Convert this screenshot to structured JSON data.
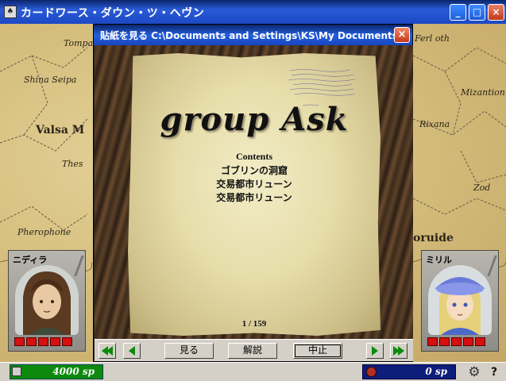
{
  "window": {
    "title": "カードワース・ダウン・ツ・ヘヴン",
    "icon": "card-icon",
    "controls": {
      "minimize": "_",
      "maximize": "□",
      "close": "×"
    }
  },
  "map": {
    "towns": [
      "Tompa",
      "Shina Seipa",
      "Valsa M",
      "Thes",
      "Pherophone",
      "Ferl oth",
      "Mizantion",
      "Rixana",
      "Zod",
      "oruide"
    ]
  },
  "dialog": {
    "title": "貼紙を見る C:\\Documents and Settings\\KS\\My Documents\\まとめ…",
    "close": "×",
    "paper": {
      "heading": "group Ask",
      "contents_label": "Contents",
      "contents": [
        "ゴブリンの洞窟",
        "交易都市リューン",
        "交易都市リューン"
      ],
      "page_counter": "1 / 159"
    },
    "toolbar": {
      "view_label": "見る",
      "explain_label": "解説",
      "cancel_label": "中止"
    }
  },
  "party": [
    {
      "name": "ニディラ",
      "hp_pips": 5
    },
    {
      "name": "ミリル",
      "hp_pips": 5
    }
  ],
  "status": {
    "money_left": "4000 sp",
    "money_right": "0 sp",
    "help": "?"
  },
  "colors": {
    "titlebar": "#245edc",
    "hp": "#d60f0f",
    "money_left_bg": "#0d8a0d",
    "money_right_bg": "#0c1d7a",
    "nav_arrow": "#0a8a0a"
  }
}
